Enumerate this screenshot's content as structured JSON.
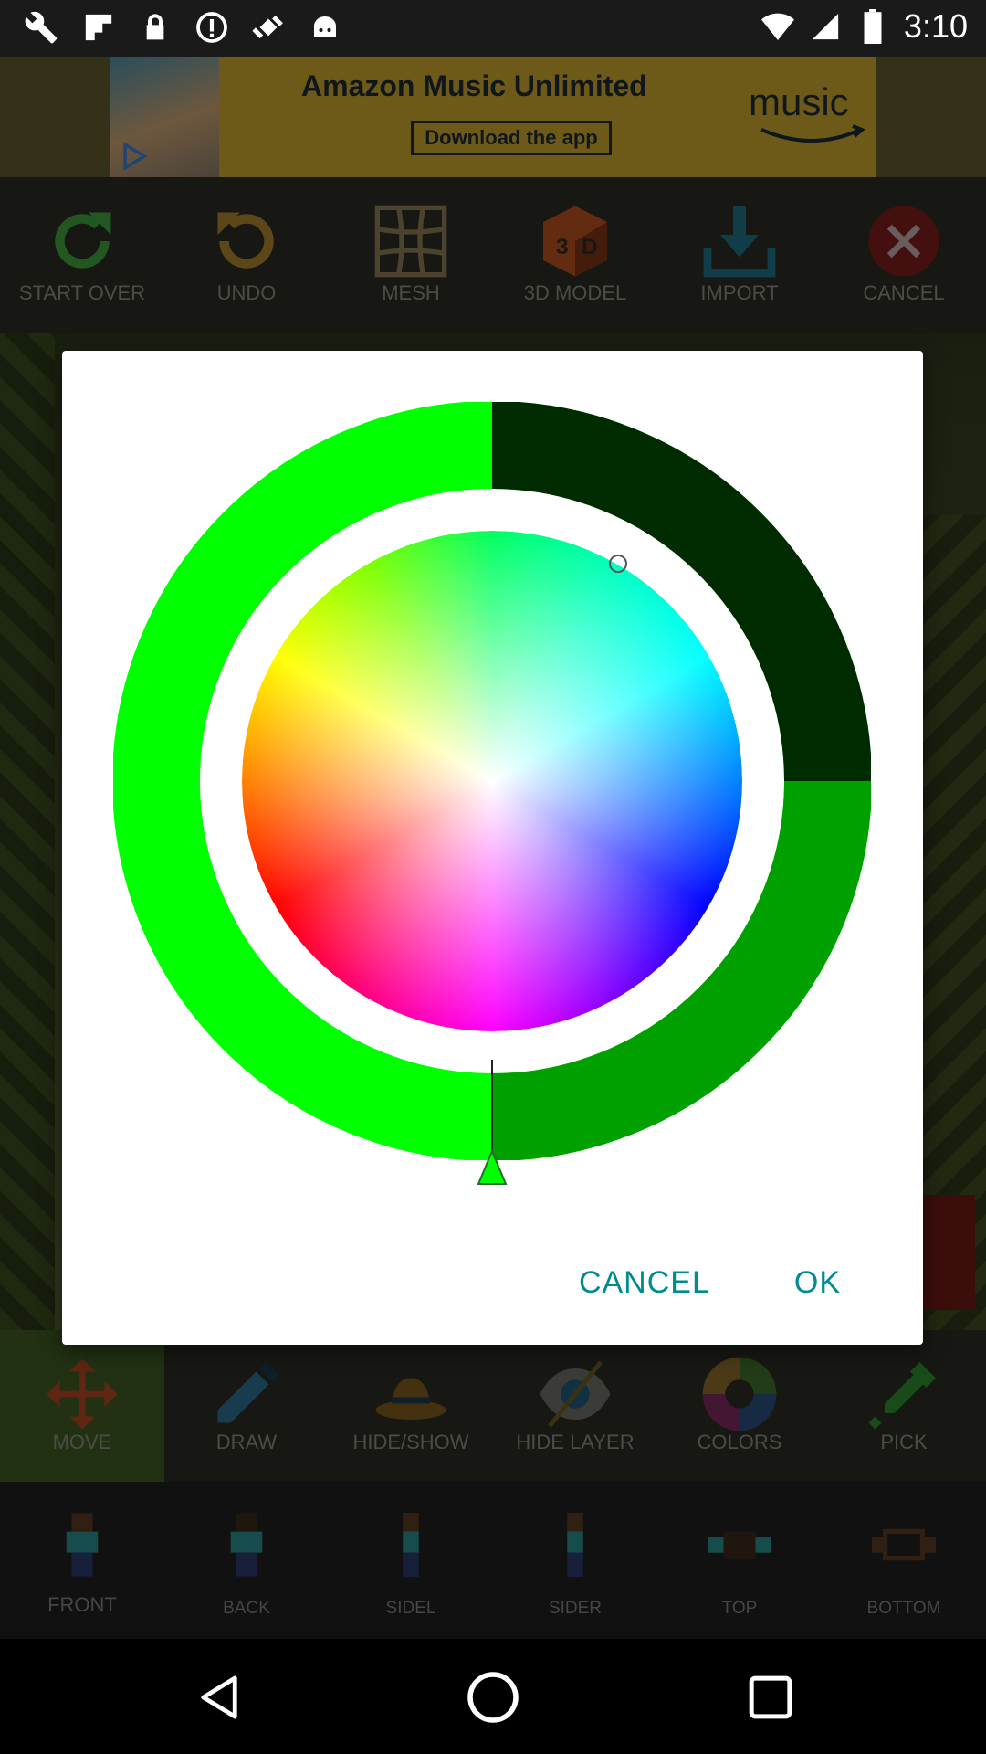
{
  "status_bar": {
    "time": "3:10",
    "left_icons": [
      "wrench-icon",
      "flipboard-icon",
      "lock-icon",
      "info-icon",
      "fake-gps-icon",
      "android-icon"
    ],
    "right_icons": [
      "wifi-icon",
      "signal-icon",
      "battery-icon"
    ]
  },
  "ad": {
    "headline": "Amazon Music Unlimited",
    "cta": "Download the app",
    "logo": "music"
  },
  "top_toolbar": {
    "items": [
      {
        "label": "START OVER",
        "icon": "refresh-icon"
      },
      {
        "label": "UNDO",
        "icon": "undo-icon"
      },
      {
        "label": "MESH",
        "icon": "mesh-icon"
      },
      {
        "label": "3D MODEL",
        "icon": "3d-cube-icon"
      },
      {
        "label": "IMPORT",
        "icon": "download-icon"
      },
      {
        "label": "CANCEL",
        "icon": "close-icon"
      }
    ]
  },
  "tool_row1": {
    "items": [
      {
        "label": "MOVE",
        "icon": "move-arrows-icon",
        "active": true
      },
      {
        "label": "DRAW",
        "icon": "pencil-icon"
      },
      {
        "label": "HIDE/SHOW",
        "icon": "hat-icon"
      },
      {
        "label": "HIDE LAYER",
        "icon": "eye-icon"
      },
      {
        "label": "COLORS",
        "icon": "color-ring-icon"
      },
      {
        "label": "PICK",
        "icon": "eyedropper-icon"
      }
    ]
  },
  "tool_row2": {
    "items": [
      {
        "label": "FRONT",
        "icon": "skin-front-icon"
      },
      {
        "label": "BACK",
        "icon": "skin-back-icon"
      },
      {
        "label": "SIDEL",
        "icon": "skin-side-left-icon"
      },
      {
        "label": "SIDER",
        "icon": "skin-side-right-icon"
      },
      {
        "label": "TOP",
        "icon": "skin-top-icon"
      },
      {
        "label": "BOTTOM",
        "icon": "skin-bottom-icon"
      }
    ]
  },
  "dialog": {
    "cancel_label": "CANCEL",
    "ok_label": "OK",
    "selected_color": "#00ff00",
    "accent_color": "#008a94"
  },
  "nav_bar": {
    "icons": [
      "back-icon",
      "home-icon",
      "recents-icon"
    ]
  }
}
